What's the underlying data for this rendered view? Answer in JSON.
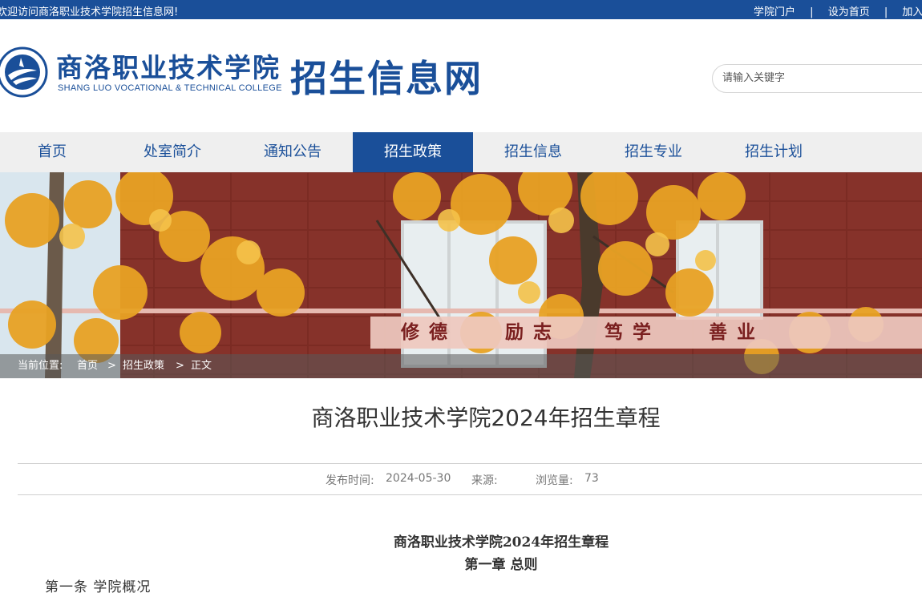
{
  "topbar": {
    "welcome": "欢迎访问商洛职业技术学院招生信息网!",
    "links": [
      "学院门户",
      "设为首页",
      "加入收藏"
    ],
    "separator": "|"
  },
  "header": {
    "college_name_cn": "商洛职业技术学院",
    "college_name_en": "SHANG LUO  VOCATIONAL  &  TECHNICAL  COLLEGE",
    "site_title": "招生信息网"
  },
  "search": {
    "placeholder": "请输入关键字"
  },
  "nav": {
    "items": [
      {
        "label": "首页"
      },
      {
        "label": "处室简介"
      },
      {
        "label": "通知公告"
      },
      {
        "label": "招生政策"
      },
      {
        "label": "招生信息"
      },
      {
        "label": "招生专业"
      },
      {
        "label": "招生计划"
      }
    ],
    "active_index": 3
  },
  "banner": {
    "motto": [
      "修德",
      "励志",
      "笃学",
      "善业"
    ]
  },
  "breadcrumb": {
    "prefix": "当前位置:",
    "items": [
      "首页",
      "招生政策",
      "正文"
    ],
    "separator": ">"
  },
  "article": {
    "title": "商洛职业技术学院2024年招生章程",
    "publish_label": "发布时间:",
    "publish_date": "2024-05-30",
    "source_label": "来源:",
    "views_label": "浏览量:",
    "views": "73",
    "body_title": "商洛职业技术学院2024年招生章程",
    "chapter": "第一章 总则",
    "section": "第一条 学院概况"
  },
  "colors": {
    "brand_blue": "#1a4f99",
    "nav_bg": "#efefef",
    "motto_red": "#7a1f1f"
  }
}
